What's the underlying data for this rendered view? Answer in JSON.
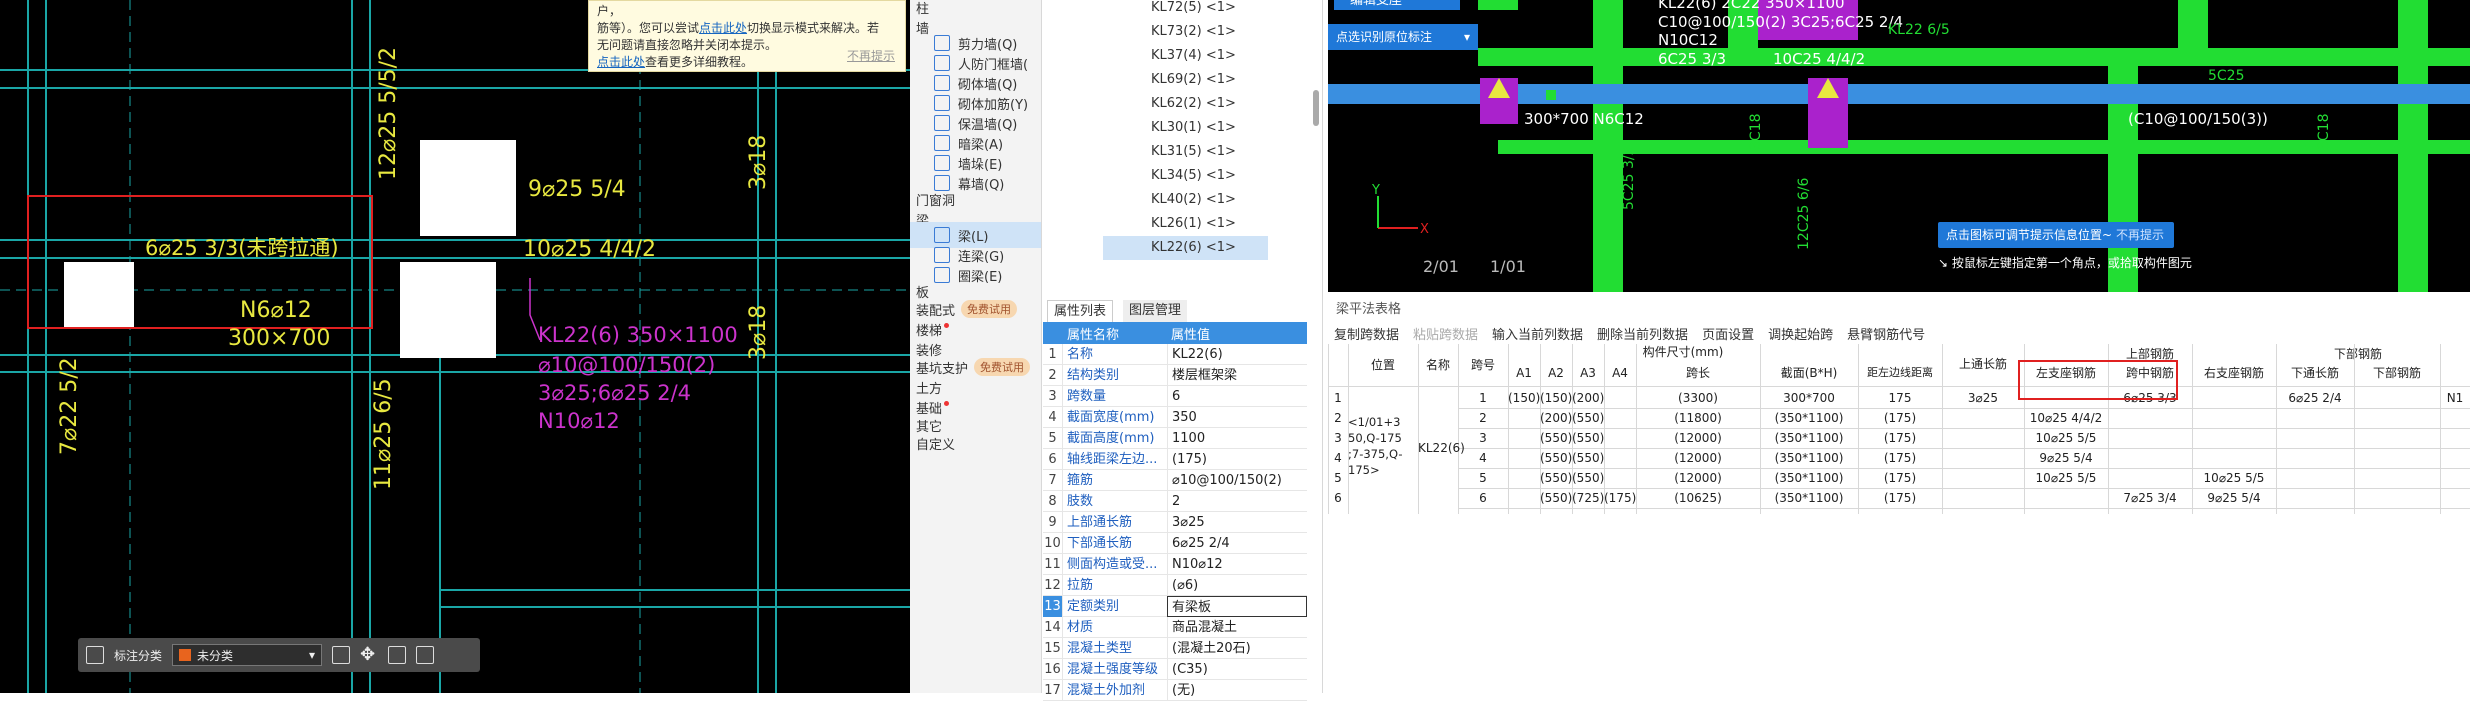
{
  "tip": {
    "line1": "户，",
    "line2": "筋等）。您可以尝试",
    "link1": "点击此处",
    "line2b": "切换显示模式来解决。若",
    "line3": "无问题请直接忽略并关闭本提示。",
    "link2": "点击此处",
    "line4": "查看更多详细教程。",
    "dismiss": "不再提示"
  },
  "cad_left": {
    "labels": [
      "12⌀25 5/5/2",
      "6⌀25 3/3(未跨拉通)",
      "9⌀25 5/4",
      "10⌀25 4/4/2",
      "N6⌀12",
      "300×700",
      "KL22(6) 350×1100",
      "⌀10@100/150(2)",
      "3⌀25;6⌀25 2/4",
      "N10⌀12",
      "3⌀18",
      "3⌀18",
      "7⌀22 5/2",
      "11⌀25 6/5"
    ]
  },
  "toolbar": {
    "label": "标注分类",
    "selected": "未分类"
  },
  "nav": {
    "items": [
      {
        "label": "柱",
        "type": "group"
      },
      {
        "label": "墙",
        "type": "group"
      },
      {
        "label": "剪力墙(Q)",
        "type": "sub"
      },
      {
        "label": "人防门框墙(",
        "type": "sub"
      },
      {
        "label": "砌体墙(Q)",
        "type": "sub"
      },
      {
        "label": "砌体加筋(Y)",
        "type": "sub"
      },
      {
        "label": "保温墙(Q)",
        "type": "sub"
      },
      {
        "label": "暗梁(A)",
        "type": "sub"
      },
      {
        "label": "墙垛(E)",
        "type": "sub"
      },
      {
        "label": "幕墙(Q)",
        "type": "sub"
      },
      {
        "label": "门窗洞",
        "type": "group"
      },
      {
        "label": "梁",
        "type": "group"
      },
      {
        "label": "梁(L)",
        "type": "sub"
      },
      {
        "label": "连梁(G)",
        "type": "sub"
      },
      {
        "label": "圈梁(E)",
        "type": "sub"
      },
      {
        "label": "板",
        "type": "group"
      },
      {
        "label": "装配式",
        "type": "group"
      },
      {
        "label": "楼梯",
        "type": "group"
      },
      {
        "label": "装修",
        "type": "group"
      },
      {
        "label": "基坑支护",
        "type": "group"
      },
      {
        "label": "土方",
        "type": "group"
      },
      {
        "label": "基础",
        "type": "group"
      },
      {
        "label": "其它",
        "type": "group"
      },
      {
        "label": "自定义",
        "type": "group"
      }
    ],
    "badge": "免费试用"
  },
  "components": [
    "KL72(5) <1>",
    "KL73(2) <1>",
    "KL37(4) <1>",
    "KL69(2) <1>",
    "KL62(2) <1>",
    "KL30(1) <1>",
    "KL31(5) <1>",
    "KL34(5) <1>",
    "KL40(2) <1>",
    "KL26(1) <1>",
    "KL22(6) <1>"
  ],
  "props": {
    "tabs": [
      "属性列表",
      "图层管理"
    ],
    "col_name": "属性名称",
    "col_value": "属性值",
    "rows": [
      {
        "n": "1",
        "k": "名称",
        "v": "KL22(6)"
      },
      {
        "n": "2",
        "k": "结构类别",
        "v": "楼层框架梁"
      },
      {
        "n": "3",
        "k": "跨数量",
        "v": "6"
      },
      {
        "n": "4",
        "k": "截面宽度(mm)",
        "v": "350"
      },
      {
        "n": "5",
        "k": "截面高度(mm)",
        "v": "1100"
      },
      {
        "n": "6",
        "k": "轴线距梁左边...",
        "v": "(175)"
      },
      {
        "n": "7",
        "k": "箍筋",
        "v": "⌀10@100/150(2)"
      },
      {
        "n": "8",
        "k": "肢数",
        "v": "2"
      },
      {
        "n": "9",
        "k": "上部通长筋",
        "v": "3⌀25"
      },
      {
        "n": "10",
        "k": "下部通长筋",
        "v": "6⌀25 2/4"
      },
      {
        "n": "11",
        "k": "侧面构造或受...",
        "v": "N10⌀12"
      },
      {
        "n": "12",
        "k": "拉筋",
        "v": "(⌀6)"
      },
      {
        "n": "13",
        "k": "定额类别",
        "v": "有梁板"
      },
      {
        "n": "14",
        "k": "材质",
        "v": "商品混凝土"
      },
      {
        "n": "15",
        "k": "混凝土类型",
        "v": "(混凝土20石)"
      },
      {
        "n": "16",
        "k": "混凝土强度等级",
        "v": "(C35)"
      },
      {
        "n": "17",
        "k": "混凝土外加剂",
        "v": "(无)"
      }
    ]
  },
  "cad_right": {
    "btn1": "编辑支座",
    "btn2": "点选识别原位标注",
    "texts": [
      "KL22(6) 2C22 350×1100",
      "C10@100/150(2) 3C25;6C25 2/4",
      "N10C12",
      "6C25 3/3",
      "10C25 4/4/2",
      "300*700 N6C12",
      "(C10@100/150(3))",
      "KL22 6/5",
      "5C25",
      "3C18",
      "3C18",
      "5C25 3/2",
      "12C25 6/6",
      "2/01",
      "1/01",
      "X",
      "Y"
    ],
    "hint": "点击图标可调节提示信息位置~",
    "hint_dismiss": "不再提示",
    "pick": "按鼠标左键指定第一个角点，或拾取构件图元"
  },
  "table": {
    "title": "梁平法表格",
    "tools": [
      "复制跨数据",
      "粘贴跨数据",
      "输入当前列数据",
      "删除当前列数据",
      "页面设置",
      "调换起始跨",
      "悬臂钢筋代号"
    ],
    "headers": {
      "pos": "位置",
      "name": "名称",
      "span": "跨号",
      "dim": "构件尺寸(mm)",
      "a1": "A1",
      "a2": "A2",
      "a3": "A3",
      "a4": "A4",
      "len": "跨长",
      "sec": "截面(B*H)",
      "off": "距左边线距离",
      "top_long": "上通长筋",
      "top": "上部钢筋",
      "left": "左支座钢筋",
      "mid": "跨中钢筋",
      "right": "右支座钢筋",
      "bot_long": "下通长筋",
      "bot": "下部钢筋",
      "botbar": "下部钢筋",
      "n_col": "N1"
    },
    "position": "<1/01+3\n50,Q-175\n;7-375,Q-\n175>",
    "beam_name": "KL22(6)",
    "rows": [
      {
        "idx": "1",
        "span": "1",
        "a1": "(150)",
        "a2": "(150)",
        "a3": "(200)",
        "a4": "",
        "len": "(3300)",
        "sec": "300*700",
        "off": "175",
        "tl": "3⌀25",
        "left": "",
        "mid": "6⌀25 3/3",
        "right": "",
        "bl": "6⌀25 2/4"
      },
      {
        "idx": "2",
        "span": "2",
        "a1": "",
        "a2": "(200)",
        "a3": "(550)",
        "a4": "",
        "len": "(11800)",
        "sec": "(350*1100)",
        "off": "(175)",
        "tl": "",
        "left": "10⌀25 4/4/2",
        "mid": "",
        "right": "",
        "bl": ""
      },
      {
        "idx": "3",
        "span": "3",
        "a1": "",
        "a2": "(550)",
        "a3": "(550)",
        "a4": "",
        "len": "(12000)",
        "sec": "(350*1100)",
        "off": "(175)",
        "tl": "",
        "left": "10⌀25 5/5",
        "mid": "",
        "right": "",
        "bl": ""
      },
      {
        "idx": "4",
        "span": "4",
        "a1": "",
        "a2": "(550)",
        "a3": "(550)",
        "a4": "",
        "len": "(12000)",
        "sec": "(350*1100)",
        "off": "(175)",
        "tl": "",
        "left": "9⌀25 5/4",
        "mid": "",
        "right": "",
        "bl": ""
      },
      {
        "idx": "5",
        "span": "5",
        "a1": "",
        "a2": "(550)",
        "a3": "(550)",
        "a4": "",
        "len": "(12000)",
        "sec": "(350*1100)",
        "off": "(175)",
        "tl": "",
        "left": "10⌀25 5/5",
        "mid": "",
        "right": "10⌀25 5/5",
        "bl": ""
      },
      {
        "idx": "6",
        "span": "6",
        "a1": "",
        "a2": "(550)",
        "a3": "(725)",
        "a4": "(175)",
        "len": "(10625)",
        "sec": "(350*1100)",
        "off": "(175)",
        "tl": "",
        "left": "",
        "mid": "7⌀25 3/4",
        "right": "9⌀25 5/4",
        "bl": ""
      }
    ]
  },
  "colors": {
    "cad_bg": "#000000",
    "cad_yellow": "#e8e840",
    "cad_green": "#22dd33",
    "cad_magenta": "#cc33cc",
    "cad_cyan": "#1aa6a6",
    "accent": "#1f78d8",
    "highlight": "#e02020"
  }
}
